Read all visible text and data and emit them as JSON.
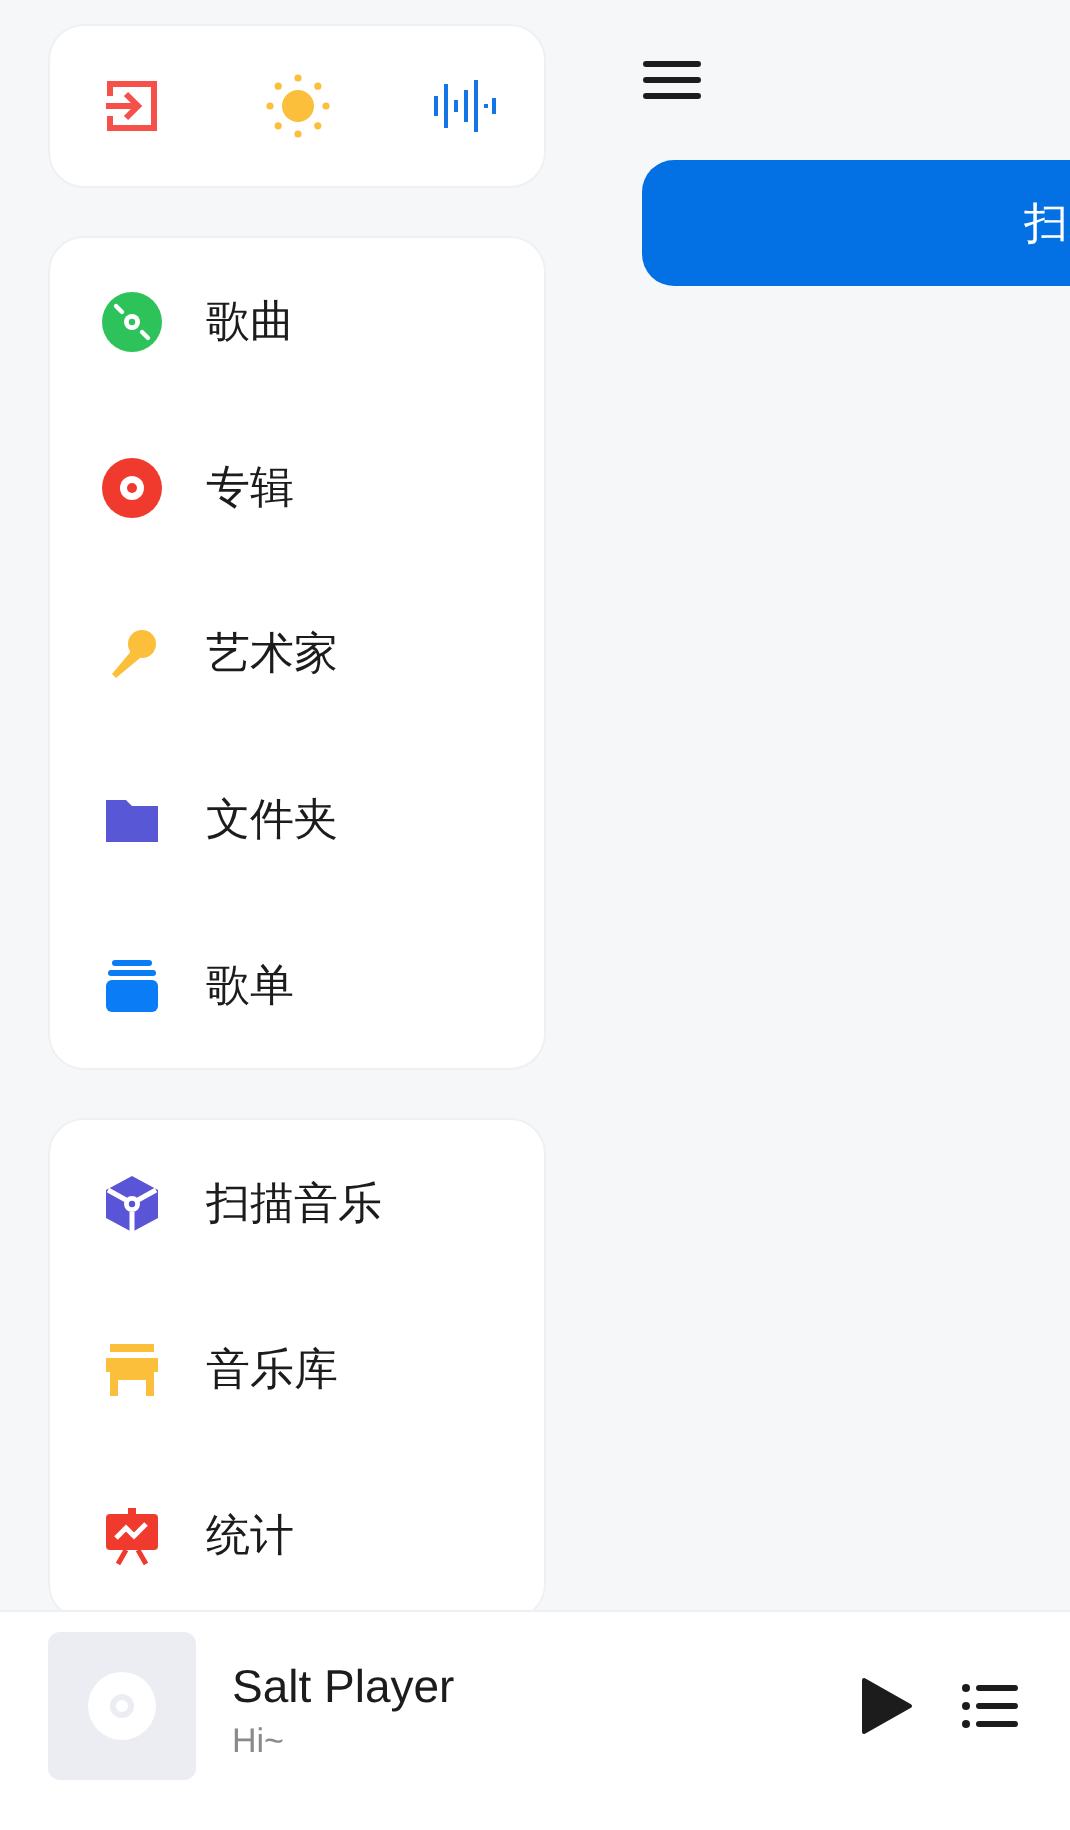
{
  "drawer": {
    "menu_groups": [
      {
        "items": [
          {
            "label": "歌曲"
          },
          {
            "label": "专辑"
          },
          {
            "label": "艺术家"
          },
          {
            "label": "文件夹"
          },
          {
            "label": "歌单"
          }
        ]
      },
      {
        "items": [
          {
            "label": "扫描音乐"
          },
          {
            "label": "音乐库"
          },
          {
            "label": "统计"
          }
        ]
      }
    ]
  },
  "main": {
    "scan_button": "扫"
  },
  "now_playing": {
    "title": "Salt Player",
    "subtitle": "Hi~"
  }
}
